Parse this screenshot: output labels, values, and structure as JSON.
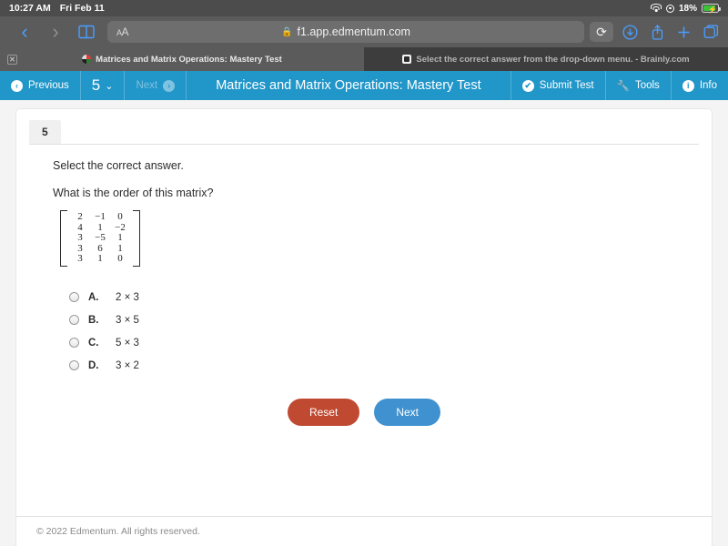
{
  "status_bar": {
    "time": "10:27 AM",
    "date": "Fri Feb 11",
    "wifi_icon": "wifi-icon",
    "location_icon": "location-icon",
    "battery_percent": "18%",
    "battery_icon": "battery-charging-icon"
  },
  "browser": {
    "back_icon": "chevron-left-icon",
    "forward_icon": "chevron-right-icon",
    "bookmarks_icon": "book-icon",
    "text_size_label": "A",
    "text_size_label_small": "A",
    "lock_icon": "lock-icon",
    "url": "f1.app.edmentum.com",
    "reload_icon": "reload-icon",
    "downloads_icon": "download-icon",
    "share_icon": "share-icon",
    "new_tab_icon": "plus-icon",
    "tabs_icon": "tabs-icon",
    "tabs": [
      {
        "title": "Matrices and Matrix Operations: Mastery Test",
        "active": true,
        "close_icon": "close-icon",
        "favicon": "edmentum-favicon"
      },
      {
        "title": "Select the correct answer from the drop-down menu. - Brainly.com",
        "active": false,
        "favicon": "brainly-favicon"
      }
    ]
  },
  "app_header": {
    "previous_label": "Previous",
    "previous_icon": "circle-left-arrow-icon",
    "question_number": "5",
    "question_dropdown_icon": "chevron-down-icon",
    "next_label": "Next",
    "next_icon": "circle-right-arrow-icon",
    "title": "Matrices and Matrix Operations: Mastery Test",
    "submit_label": "Submit Test",
    "submit_icon": "check-circle-icon",
    "tools_label": "Tools",
    "tools_icon": "wrench-icon",
    "info_label": "Info",
    "info_icon": "info-circle-icon",
    "accent_color": "#2196c9"
  },
  "question": {
    "tab_label": "5",
    "instruction": "Select the correct answer.",
    "prompt": "What is the order of this matrix?",
    "matrix": {
      "rows": 5,
      "cols": 3,
      "values": [
        [
          "2",
          "−1",
          "0"
        ],
        [
          "4",
          "1",
          "−2"
        ],
        [
          "3",
          "−5",
          "1"
        ],
        [
          "3",
          "6",
          "1"
        ],
        [
          "3",
          "1",
          "0"
        ]
      ]
    },
    "options": [
      {
        "letter": "A.",
        "text": "2 × 3",
        "selected": false
      },
      {
        "letter": "B.",
        "text": "3 × 5",
        "selected": false
      },
      {
        "letter": "C.",
        "text": "5 × 3",
        "selected": false
      },
      {
        "letter": "D.",
        "text": "3 × 2",
        "selected": false
      }
    ],
    "reset_label": "Reset",
    "next_label": "Next",
    "reset_color": "#c04a31",
    "next_color": "#3f92cf"
  },
  "footer": {
    "copyright": "© 2022 Edmentum. All rights reserved."
  }
}
